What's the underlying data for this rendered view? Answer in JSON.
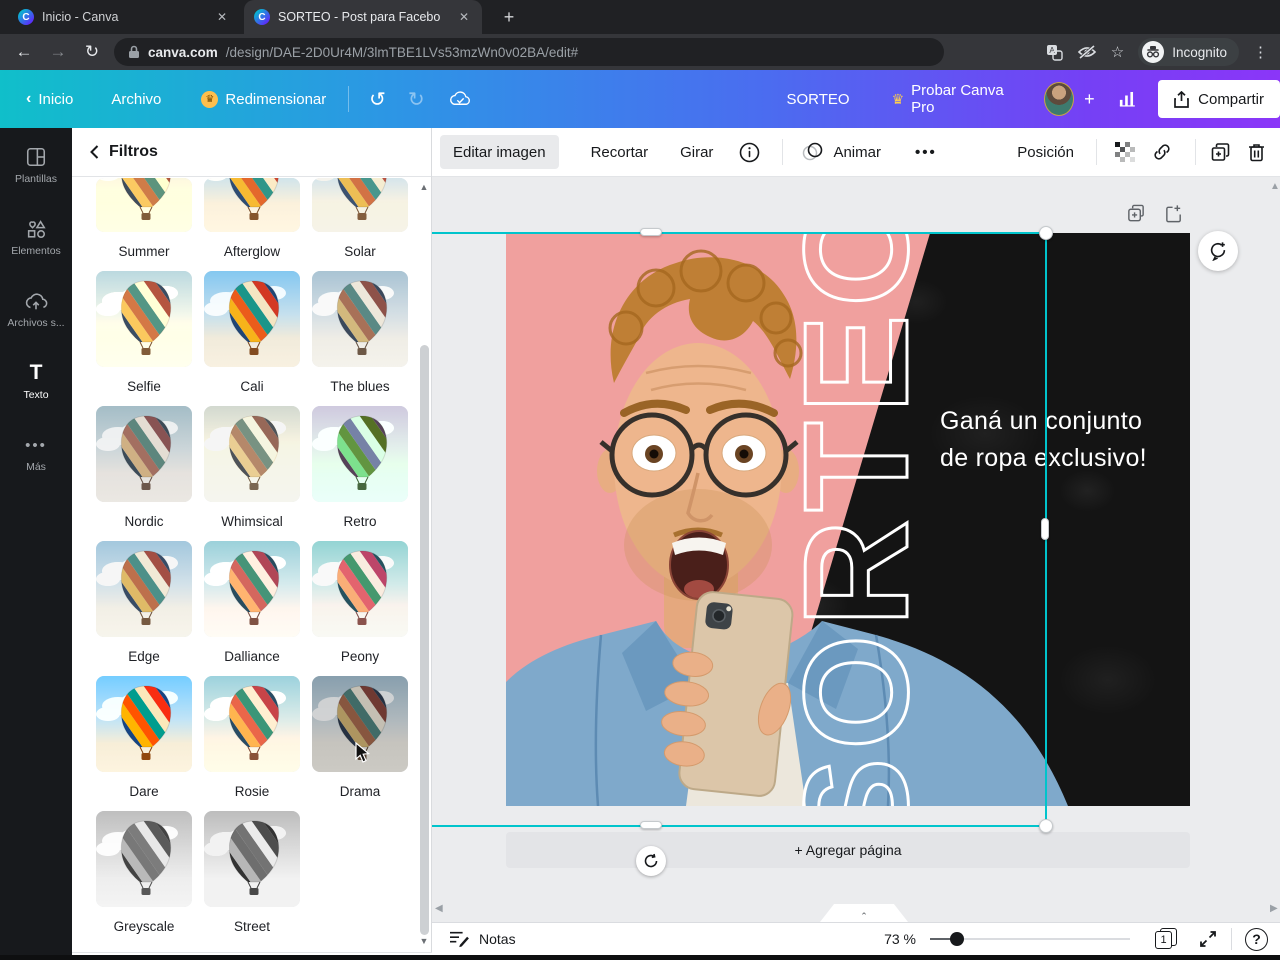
{
  "browser": {
    "tabs": [
      {
        "title": "Inicio - Canva"
      },
      {
        "title": "SORTEO - Post para Facebo"
      }
    ],
    "new_tab_label": "+",
    "url_host": "canva.com",
    "url_path": "/design/DAE-2D0Ur4M/3lmTBE1LVs53mzWn0v02BA/edit#",
    "incognito_label": "Incognito"
  },
  "header": {
    "back_label": "Inicio",
    "file_menu_label": "Archivo",
    "resize_label": "Redimensionar",
    "doc_title": "SORTEO",
    "pro_button_label": "Probar Canva Pro",
    "share_button_label": "Compartir"
  },
  "toolbar": {
    "edit_image_label": "Editar imagen",
    "crop_label": "Recortar",
    "rotate_label": "Girar",
    "animate_label": "Animar",
    "position_label": "Posición",
    "more_label": "•••"
  },
  "sidebar": {
    "items": [
      {
        "label": "Plantillas"
      },
      {
        "label": "Elementos"
      },
      {
        "label": "Archivos s..."
      },
      {
        "label": "Texto"
      },
      {
        "label": "Más"
      }
    ]
  },
  "panel": {
    "title": "Filtros",
    "filters": [
      {
        "name": "Summer"
      },
      {
        "name": "Afterglow"
      },
      {
        "name": "Solar"
      },
      {
        "name": "Selfie"
      },
      {
        "name": "Cali"
      },
      {
        "name": "The blues"
      },
      {
        "name": "Nordic"
      },
      {
        "name": "Whimsical"
      },
      {
        "name": "Retro"
      },
      {
        "name": "Edge"
      },
      {
        "name": "Dalliance"
      },
      {
        "name": "Peony"
      },
      {
        "name": "Dare"
      },
      {
        "name": "Rosie"
      },
      {
        "name": "Drama"
      },
      {
        "name": "Greyscale"
      },
      {
        "name": "Street"
      }
    ]
  },
  "canvas": {
    "design_headline_line1": "Ganá un conjunto",
    "design_headline_line2": "de ropa exclusivo!",
    "design_vertical_word": "SORTEO",
    "add_page_label": "+ Agregar página"
  },
  "statusbar": {
    "notes_label": "Notas",
    "zoom_value": "73 %",
    "page_number": "1"
  },
  "colors": {
    "selection_teal": "#00c4cc",
    "design_pink": "#f0a09e",
    "header_gradient": [
      "#00c4cc",
      "#3d7ff0",
      "#8b3dff"
    ]
  }
}
